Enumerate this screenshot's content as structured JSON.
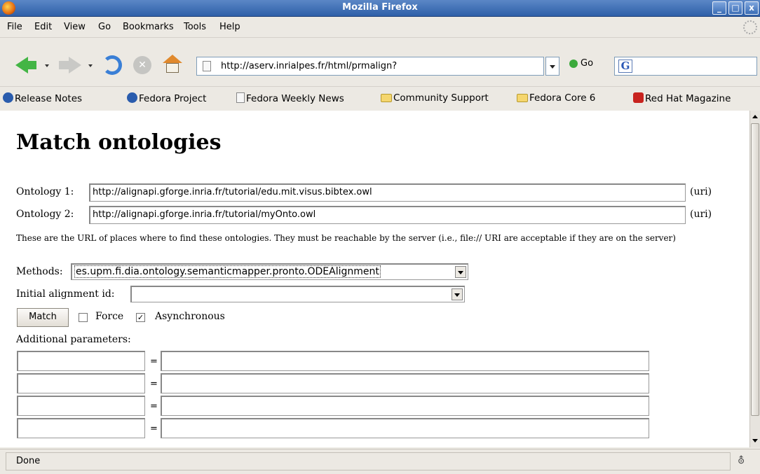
{
  "window": {
    "title": "Mozilla Firefox",
    "min_glyph": "_",
    "max_glyph": "□",
    "close_glyph": "x"
  },
  "menu": {
    "items": [
      {
        "label": "File"
      },
      {
        "label": "Edit"
      },
      {
        "label": "View"
      },
      {
        "label": "Go"
      },
      {
        "label": "Bookmarks"
      },
      {
        "label": "Tools"
      },
      {
        "label": "Help"
      }
    ]
  },
  "nav": {
    "url": "http://aserv.inrialpes.fr/html/prmalign?",
    "go_label": "Go",
    "stop_glyph": "✕",
    "search_glyph": "G"
  },
  "bookmarks": {
    "items": [
      {
        "label": "Release Notes",
        "icon": "fedora-icon"
      },
      {
        "label": "Fedora Project",
        "icon": "fedora-icon"
      },
      {
        "label": "Fedora Weekly News",
        "icon": "page-icon"
      },
      {
        "label": "Community Support",
        "icon": "folder-icon"
      },
      {
        "label": "Fedora Core 6",
        "icon": "folder-icon"
      },
      {
        "label": "Red Hat Magazine",
        "icon": "redhat-icon"
      }
    ]
  },
  "page": {
    "title": "Match ontologies",
    "ontology1_label": "Ontology 1:",
    "ontology1_value": "http://alignapi.gforge.inria.fr/tutorial/edu.mit.visus.bibtex.owl",
    "ontology2_label": "Ontology 2:",
    "ontology2_value": "http://alignapi.gforge.inria.fr/tutorial/myOnto.owl",
    "uri_suffix": "(uri)",
    "note": "These are the URL of places where to find these ontologies. They must be reachable by the server (i.e., file:// URI are acceptable if they are on the server)",
    "methods_label": "Methods:",
    "methods_value": "es.upm.fi.dia.ontology.semanticmapper.pronto.ODEAlignment",
    "initial_label": "Initial alignment id:",
    "initial_value": "",
    "match_label": "Match",
    "force_label": "Force",
    "force_checked_glyph": "",
    "async_label": "Asynchronous",
    "async_checked_glyph": "✓",
    "additional_label": "Additional parameters:",
    "param_eq": "="
  },
  "status": {
    "text": "Done",
    "icon_glyph": "⛢"
  }
}
